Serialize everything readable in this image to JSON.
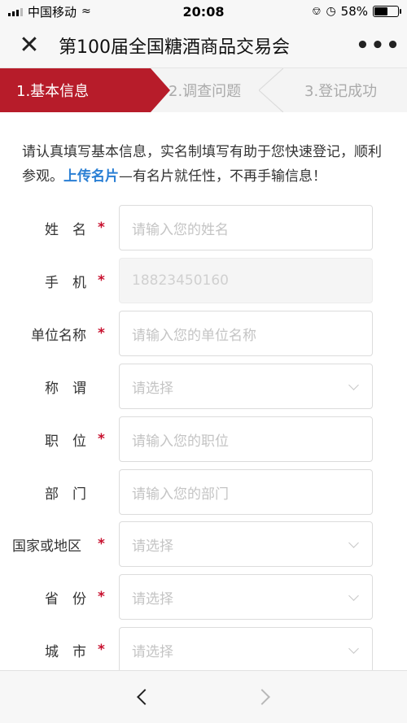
{
  "status_bar": {
    "carrier": "中国移动",
    "time": "20:08",
    "battery_percent": "58%",
    "battery_level": 0.58
  },
  "navbar": {
    "close_icon": "close-icon",
    "title": "第100届全国糖酒商品交易会",
    "more_icon": "more-icon"
  },
  "steps": [
    {
      "label": "1.基本信息",
      "active": true
    },
    {
      "label": "2.调查问题",
      "active": false
    },
    {
      "label": "3.登记成功",
      "active": false
    }
  ],
  "intro": {
    "text_before": "请认真填写基本信息，实名制填写有助于您快速登记，顺利参观。",
    "link": "上传名片",
    "text_after": "—有名片就任性，不再手输信息！"
  },
  "form": {
    "fields": [
      {
        "label": "姓　名",
        "required": "*",
        "placeholder": "请输入您的姓名"
      },
      {
        "label": "手　机",
        "required": "*",
        "value": "18823450160"
      },
      {
        "label": "单位名称",
        "required": "*",
        "placeholder": "请输入您的单位名称"
      },
      {
        "label": "称　谓",
        "required": "",
        "placeholder": "请选择"
      },
      {
        "label": "职　位",
        "required": "*",
        "placeholder": "请输入您的职位"
      },
      {
        "label": "部　门",
        "required": "",
        "placeholder": "请输入您的部门"
      },
      {
        "label": "国家或地区",
        "required": "*",
        "placeholder": "请选择"
      },
      {
        "label": "省　份",
        "required": "*",
        "placeholder": "请选择"
      },
      {
        "label": "城　市",
        "required": "*",
        "placeholder": "请选择"
      }
    ]
  },
  "colors": {
    "accent": "#b71c2a",
    "link": "#2a7fd4",
    "required": "#c8102e"
  }
}
